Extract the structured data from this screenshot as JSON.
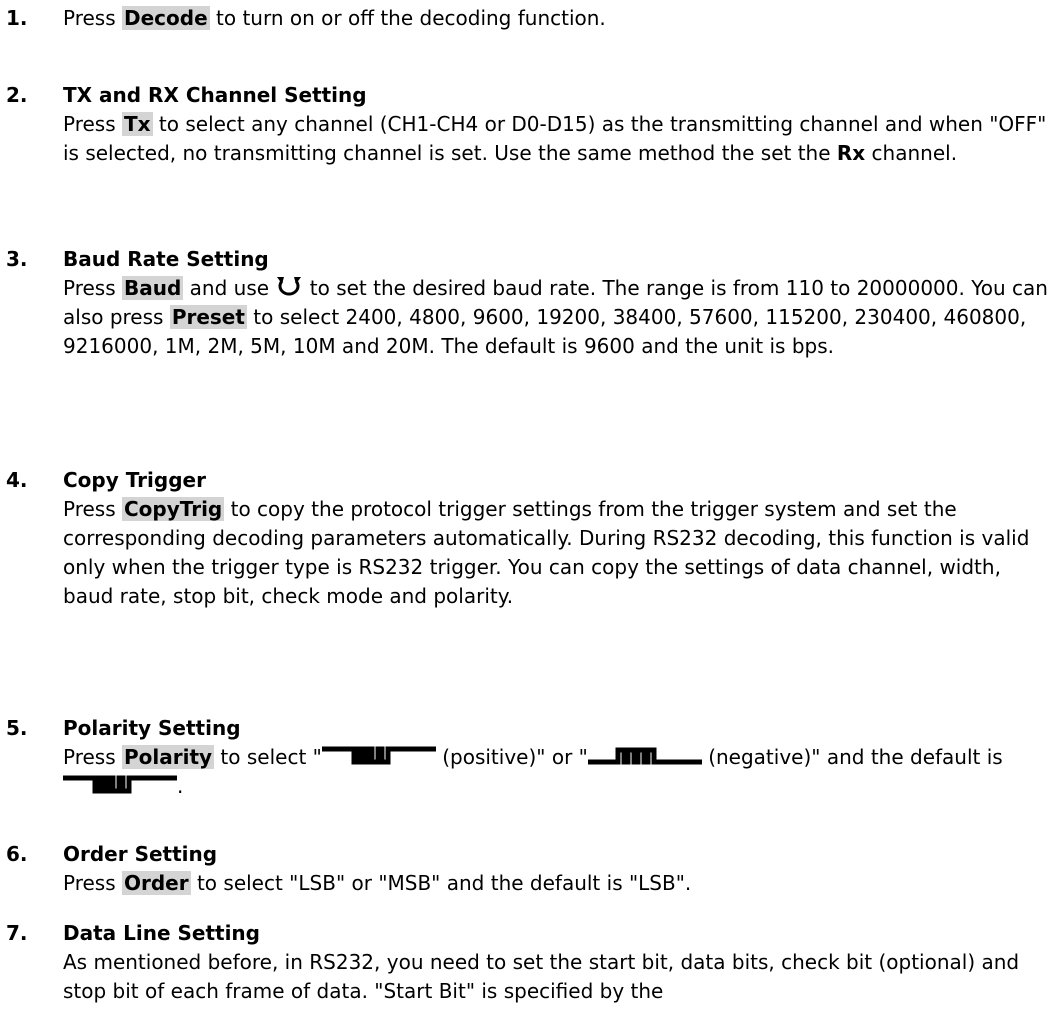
{
  "steps": [
    {
      "number": "1.",
      "parts": {
        "a": "Press ",
        "key": "Decode",
        "b": " to turn on or off the decoding function."
      }
    },
    {
      "number": "2.",
      "title": "TX and RX Channel Setting",
      "parts": {
        "a": "Press ",
        "key": "Tx",
        "b": " to select any channel (CH1-CH4 or D0-D15) as the transmitting channel and when \"OFF\" is selected, no transmitting channel is set. Use the same method the set the ",
        "bold": "Rx",
        "c": " channel."
      }
    },
    {
      "number": "3.",
      "title": "Baud Rate Setting",
      "parts": {
        "a": "Press ",
        "key1": "Baud",
        "b": " and use ",
        "icon": "multipurpose-knob-icon",
        "c": " to set the desired baud rate. The range is from 110 to 20000000. You can also press ",
        "key2": "Preset",
        "d": " to select 2400, 4800, 9600, 19200, 38400, 57600, 115200, 230400, 460800, 9216000, 1M, 2M, 5M, 10M and 20M. The default is 9600 and the unit is bps."
      }
    },
    {
      "number": "4.",
      "title": "Copy Trigger",
      "parts": {
        "a": "Press ",
        "key": "CopyTrig",
        "b": " to copy the protocol trigger settings from the trigger system and set the corresponding decoding parameters automatically. During RS232 decoding, this function is valid only when the trigger type is RS232 trigger. You can copy the settings of data channel, width, baud rate, stop bit, check mode and polarity."
      }
    },
    {
      "number": "5.",
      "title": "Polarity Setting",
      "parts": {
        "a": "Press ",
        "key": "Polarity",
        "b": " to select \"",
        "c": " (positive)\" or \"",
        "d": " (negative)\" and the default is ",
        "e": ".",
        "icon_positive": "positive-polarity-icon",
        "icon_negative": "negative-polarity-icon"
      }
    },
    {
      "number": "6.",
      "title": "Order Setting",
      "parts": {
        "a": "Press ",
        "key": "Order",
        "b": " to select \"LSB\" or \"MSB\" and the default is \"LSB\"."
      }
    },
    {
      "number": "7.",
      "title": "Data Line Setting",
      "parts": {
        "a": "As mentioned before, in RS232, you need to set the start bit, data bits, check bit (optional) and stop bit of each frame of data. \"Start Bit\" is specified by the"
      }
    }
  ]
}
